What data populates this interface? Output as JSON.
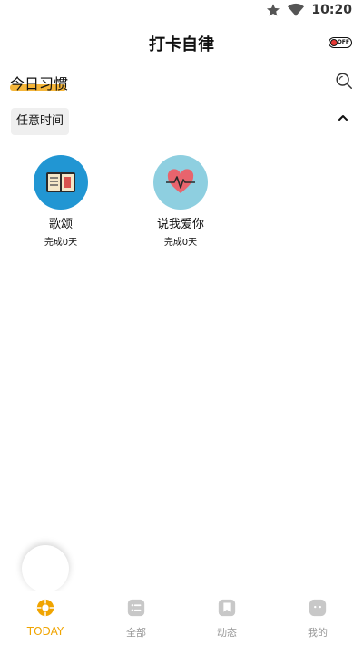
{
  "status_bar": {
    "time": "10:20"
  },
  "header": {
    "title": "打卡自律",
    "toggle_label": "OFF"
  },
  "section": {
    "title": "今日习惯"
  },
  "filter": {
    "time_label": "任意时间"
  },
  "habits": [
    {
      "name": "歌颂",
      "progress": "完成0天",
      "circle_color": "#2196d3"
    },
    {
      "name": "说我爱你",
      "progress": "完成0天",
      "circle_color": "#8ecfe0"
    }
  ],
  "nav": {
    "items": [
      {
        "label": "TODAY",
        "active": true
      },
      {
        "label": "全部"
      },
      {
        "label": "动态"
      },
      {
        "label": "我的"
      }
    ]
  },
  "colors": {
    "accent": "#f0a400",
    "underline": "#f5b63a",
    "inactive": "#999999"
  }
}
